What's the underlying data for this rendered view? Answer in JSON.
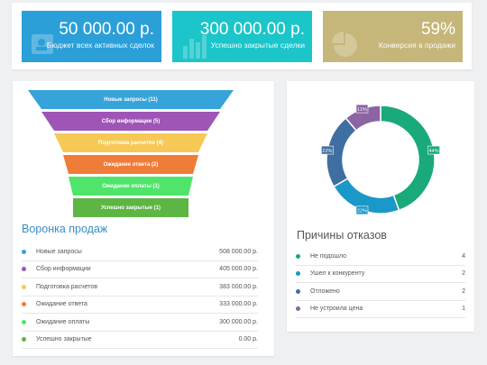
{
  "kpis": [
    {
      "value": "50 000.00 р.",
      "label": "Бюджет всех активных сделок",
      "color": "#2a9fd8",
      "icon": "wallet-icon"
    },
    {
      "value": "300 000.00 р.",
      "label": "Успешно закрытые сделки",
      "color": "#1bc5c9",
      "icon": "bar-chart-icon"
    },
    {
      "value": "59%",
      "label": "Конверсия в продажи",
      "color": "#c6b67a",
      "icon": "pie-chart-icon"
    }
  ],
  "funnel": {
    "title": "Воронка продаж",
    "stages": [
      {
        "label": "Новые запросы (11)",
        "amount": "508 000.00 р.",
        "list_label": "Новые запросы",
        "color": "#36a3da"
      },
      {
        "label": "Сбор информации (5)",
        "amount": "405 000.00 р.",
        "list_label": "Сбор информации",
        "color": "#9e55b6"
      },
      {
        "label": "Подготовка расчетов (4)",
        "amount": "383 000.00 р.",
        "list_label": "Подготовка расчетов",
        "color": "#f6c957"
      },
      {
        "label": "Ожидание ответа (2)",
        "amount": "333 000.00 р.",
        "list_label": "Ожидание ответа",
        "color": "#f07c3a"
      },
      {
        "label": "Ожидание оплаты (1)",
        "amount": "300 000.00 р.",
        "list_label": "Ожидание оплаты",
        "color": "#4ee56a"
      },
      {
        "label": "Успешно закрытые (1)",
        "amount": "0.00 р.",
        "list_label": "Успешно закрытые",
        "color": "#5db544"
      }
    ]
  },
  "chart_data": {
    "type": "pie",
    "title": "Причины отказов",
    "categories": [
      "Не подошло",
      "Ушел к конкуренту",
      "Отложено",
      "Не устроила цена"
    ],
    "counts": [
      4,
      2,
      2,
      1
    ],
    "values": [
      44,
      22,
      22,
      11
    ],
    "value_labels": [
      "44%",
      "22%",
      "22%",
      "11%"
    ],
    "colors": [
      "#1aa97b",
      "#1a98c7",
      "#3f6ea1",
      "#8c63a3"
    ]
  }
}
